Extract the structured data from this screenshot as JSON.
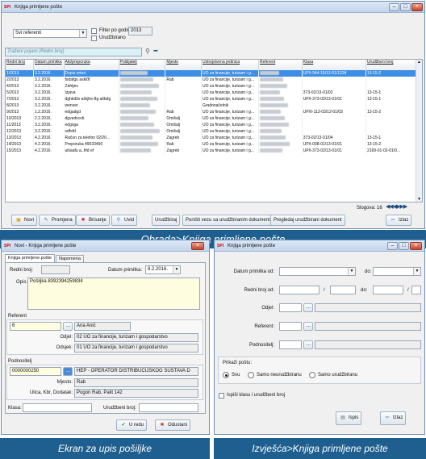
{
  "w1": {
    "title": "Knjiga primljene pošte",
    "referent_select": "Svi referenti",
    "filter_year_label": "Filter po godini",
    "year_value": "2013",
    "urudzbirano_label": "Urudžbirano",
    "search_placeholder": "Traženi pojam (Redni broj)",
    "columns": [
      "Redni broj",
      "Datum primitka",
      "Akt/preporuka",
      "Pošiljatelj",
      "Mjesto",
      "Ustrojstvena jedinica",
      "Referent",
      "Klasa",
      "Urudžbeni broj"
    ],
    "rows": [
      [
        "1/2013",
        "3.2.2016.",
        "Dopis  ertert",
        "",
        "",
        "UO za financije, turizam i g...",
        "",
        "UP/I-944-15/13-01/1234",
        "13-15-2"
      ],
      [
        "2/2013",
        "3.2.2016.",
        "fsdafgu asklðf",
        "",
        "Rab",
        "UO za financije, turizam i g...",
        "",
        "",
        ""
      ],
      [
        "4/2013",
        "3.2.2016.",
        "Zahtjev",
        "",
        "",
        "UO za financije, turizam i g...",
        "",
        "",
        ""
      ],
      [
        "5/2013",
        "3.2.2016.",
        "Izjava",
        "",
        "",
        "UO za financije, turizam i g...",
        "",
        "373-02/13-01/02",
        "13-15-1"
      ],
      [
        "7/2013",
        "3.2.2016.",
        "dghkdžs aškjhe-8g ašbdg",
        "",
        "",
        "UO za financije, turizam i g...",
        "",
        "UP/I-373-02/13-01/01",
        "13-15-1"
      ],
      [
        "8/2013",
        "3.2.2016.",
        "wenver",
        "",
        "",
        "Gradonačelnik",
        "",
        "",
        ""
      ],
      [
        "9/2013",
        "1.2.2016.",
        "edgadgd",
        "",
        "Rab",
        "UO za financije, turizam i g...",
        "",
        "UP/II-113-03/12-01/03",
        "13-15-2"
      ],
      [
        "10/2013",
        "2.2.2016.",
        "dgvedxcvb",
        "",
        "Omišalj",
        "UO za financije, turizam i g...",
        "",
        "",
        ""
      ],
      [
        "11/2013",
        "3.2.2016.",
        "edgsga",
        "",
        "Omišalj",
        "UO za financije, turizam i g...",
        "",
        "",
        ""
      ],
      [
        "12/2013",
        "3.2.2016.",
        "sdfsfd",
        "",
        "Omišalj",
        "UO za financije, turizam i g...",
        "",
        "",
        ""
      ],
      [
        "13/2013",
        "4.2.2016.",
        "Račun za telefon 02/20...",
        "",
        "Zagreb",
        "UO za financije, turizam i g...",
        "",
        "373-02/13-01/04",
        "13-15-1"
      ],
      [
        "14/2013",
        "4.2.2016.",
        "Preporuka 49033490",
        "",
        "Rab",
        "UO za financije, turizam i g...",
        "",
        "UP/I-008-01/13-01/01",
        "13-15-2"
      ],
      [
        "15/2013",
        "4.2.2016.",
        "uišaafu a..hfd ef",
        "",
        "Zagreb",
        "UO za financije, turizam i g...",
        "",
        "UP/I-373-02/13-01/01",
        "2169-01-02-01/0..."
      ]
    ],
    "slogova": "Slogova: 16",
    "btn_novi": "Novi",
    "btn_promjena": "Promjena",
    "btn_brisanje": "Brisanje",
    "btn_uvid": "Uvid",
    "btn_urudzbiraj": "Urudžbiraj",
    "btn_ponisti": "Poništi vezu sa urudžbiranim dokumentom",
    "btn_pregledaj": "Pregledaj urudžbirani dokument",
    "btn_izlaz": "Izlaz"
  },
  "caption1": "Obrada>Knjiga primljene pošte",
  "w2": {
    "title": "Novi - Knjiga primljene pošte",
    "tab1": "Knjiga primljene pošte",
    "tab2": "Napomena",
    "redni_broj_label": "Redni broj:",
    "datum_label": "Datum primitka:",
    "datum_value": "8.2.2016.",
    "opis_label": "Opis:",
    "opis_value": "Pošiljka 8392394259834",
    "referent_group": "Referent",
    "referent_code": "6",
    "referent_name": "Ana Anić",
    "odjel_label": "Odjel:",
    "odjel_value": "02 UO za financije, turizam i gospodarstvo",
    "odsjek_label": "Odsjek:",
    "odsjek_value": "01 UO za financije, turizam i gospodarstvo",
    "podnositelj_group": "Podnositelj",
    "podnositelj_code": "0000000250",
    "podnositelj_name": "HEP - OPERATOR DISTRIBUCIJSKOG SUSTAVA D",
    "mjesto_label": "Mjesto:",
    "mjesto_value": "Rab",
    "ulica_label": "Ulica, Kbr, Dodatak:",
    "ulica_value": "Pogon Rab, Palit 142",
    "klasa_label": "Klasa:",
    "urbroj_label": "Urudžbeni broj:",
    "btn_ured": "U redu",
    "btn_odustani": "Odustani"
  },
  "caption2": "Ekran za upis pošiljke",
  "w3": {
    "title": "Knjiga primljene pošte",
    "datum_od_label": "Datum primitka od:",
    "do_label": "do:",
    "redni_od_label": "Redni broj od:",
    "slash": "/",
    "odjel_label": "Odjel:",
    "referent_label": "Referent:",
    "podnositelj_label": "Podnositelj:",
    "prikazi_label": "Prikaži poštu:",
    "radio_svu": "Svu",
    "radio_neurudz": "Samo neurudžbiranu",
    "radio_urudz": "Samo urudžbiranu",
    "ispisi_klasu": "Ispiši klasu i urudžbeni broj",
    "btn_ispis": "Ispis",
    "btn_izlaz": "Izlaz"
  },
  "caption3": "Izvješća>Knjiga primljene pošte",
  "colors": {
    "caption_bg": "#1e5f8f",
    "selected_row": "#3d8ee4",
    "title_gradient": "#c4d6ec"
  }
}
